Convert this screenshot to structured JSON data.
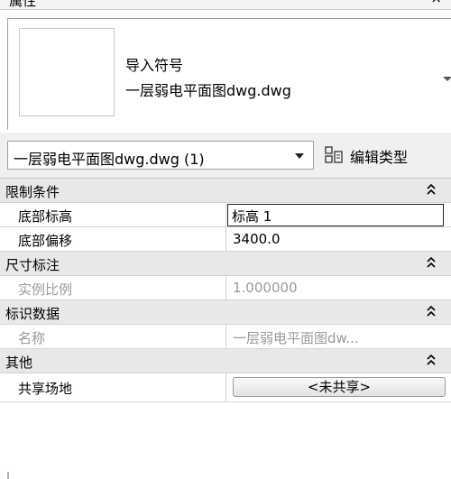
{
  "window": {
    "title": "属性",
    "close_glyph": "×"
  },
  "type_selector": {
    "line1": "导入符号",
    "line2": "一层弱电平面图dwg.dwg"
  },
  "instance_selector": {
    "value": "一层弱电平面图dwg.dwg (1)",
    "edit_type_label": "编辑类型"
  },
  "groups": [
    {
      "label": "限制条件",
      "props": [
        {
          "name": "底部标高",
          "value": "标高 1",
          "style": "edit"
        },
        {
          "name": "底部偏移",
          "value": "3400.0",
          "style": "normal"
        }
      ]
    },
    {
      "label": "尺寸标注",
      "props": [
        {
          "name": "实例比例",
          "value": "1.000000",
          "style": "disabled"
        }
      ]
    },
    {
      "label": "标识数据",
      "props": [
        {
          "name": "名称",
          "value": "一层弱电平面图dw...",
          "style": "disabled"
        }
      ]
    },
    {
      "label": "其他",
      "props": [
        {
          "name": "共享场地",
          "value": "<未共享>",
          "style": "button"
        }
      ]
    }
  ],
  "colors": {
    "group_bg": "#e8e8e8",
    "disabled_text": "#9a9a9a",
    "border": "#d4d4d4"
  }
}
